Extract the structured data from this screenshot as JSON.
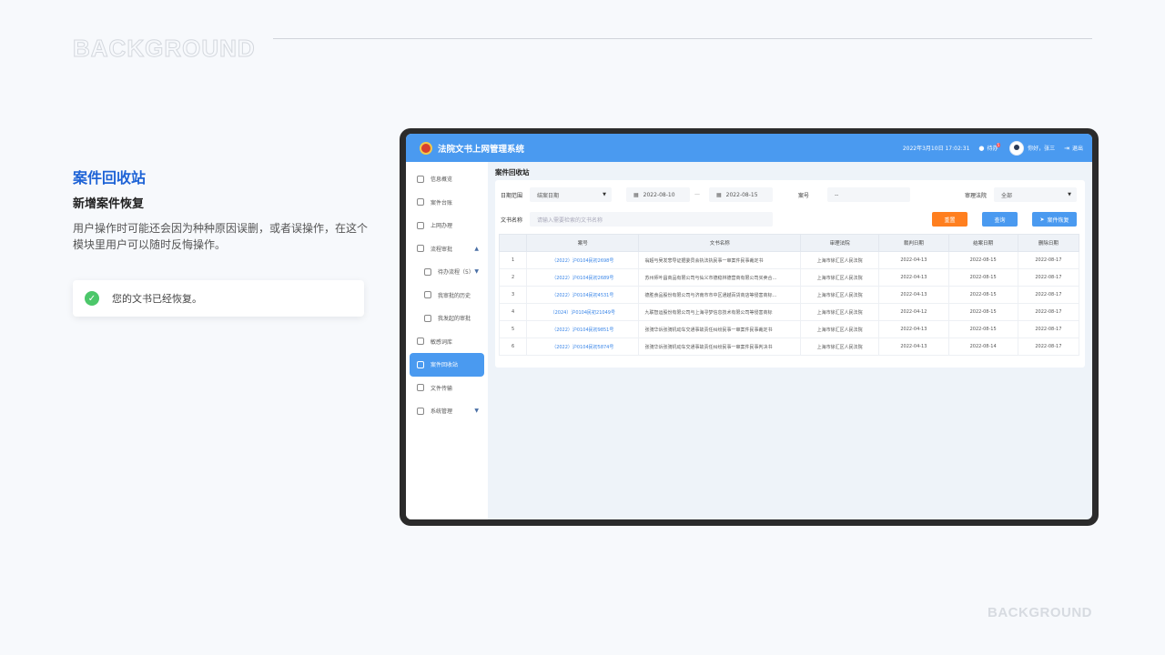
{
  "slide": {
    "bg_title": "BACKGROUND",
    "bg_bottom": "BACKGROUND",
    "title": "案件回收站",
    "subtitle": "新增案件恢复",
    "description": "用户操作时可能还会因为种种原因误删，或者误操作，在这个模块里用户可以随时反悔操作。",
    "toast": {
      "icon": "check-circle-icon",
      "text": "您的文书已经恢复。",
      "color": "#4cc76a"
    }
  },
  "app": {
    "title": "法院文书上网管理系统",
    "datetime": "2022年3月10日 17:02:31",
    "todo_label": "待办",
    "todo_badge": "5",
    "greeting": "你好，张三",
    "logout": "退出",
    "accent": "#4a9af0"
  },
  "sidebar": {
    "items": [
      {
        "label": "信息概览",
        "icon": "overview-icon"
      },
      {
        "label": "案件台账",
        "icon": "ledger-icon"
      },
      {
        "label": "上网办理",
        "icon": "online-icon"
      },
      {
        "label": "流程审批",
        "icon": "approval-icon",
        "arrow": "▲"
      },
      {
        "label": "待办流程（5）",
        "icon": "todo-icon",
        "arrow": "▼"
      },
      {
        "label": "我审批的历史",
        "icon": "history-icon"
      },
      {
        "label": "我发起的审批",
        "icon": "initiated-icon"
      },
      {
        "label": "敏感词库",
        "icon": "sensitive-icon"
      },
      {
        "label": "案件回收站",
        "icon": "recycle-icon"
      },
      {
        "label": "文件传输",
        "icon": "upload-icon"
      },
      {
        "label": "系统管理",
        "icon": "settings-icon",
        "arrow": "▼"
      }
    ]
  },
  "page": {
    "title": "案件回收站",
    "filters": {
      "date_range_label": "日期范围",
      "date_type": "结案日期",
      "date_from": "2022-08-10",
      "date_sep": "—",
      "date_to": "2022-08-15",
      "case_no_label": "案号",
      "case_no_value": "--",
      "court_label": "审理法院",
      "court_value": "全部",
      "doc_name_label": "文书名称",
      "doc_name_placeholder": "请输入需要检索的文书名称",
      "reset": "重置",
      "search": "查询",
      "restore": "案件恢复"
    },
    "table": {
      "headers": [
        "",
        "案号",
        "文书名称",
        "审理法院",
        "裁判日期",
        "结案日期",
        "删除日期"
      ],
      "rows": [
        [
          "1",
          "（2022）沪0104民初2698号",
          "翁超与吴发悲导证据委员会执法执民事一审案件民事裁定书",
          "上海市徐汇区人民法院",
          "2022-04-13",
          "2022-08-15",
          "2022-08-17"
        ],
        [
          "2",
          "（2022）沪0104民初2689号",
          "苏州师叶昌商品有限公司与仙义市德稳林德营商有限公司买卖合…",
          "上海市徐汇区人民法院",
          "2022-04-13",
          "2022-08-15",
          "2022-08-17"
        ],
        [
          "3",
          "（2022）沪0104民初4531号",
          "德胜食品股份有限公司与济南市市中区通越百货商店等侵害商标…",
          "上海市徐汇区人民法院",
          "2022-04-13",
          "2022-08-15",
          "2022-08-17"
        ],
        [
          "4",
          "（2024）沪0104民初21049号",
          "九联智运股份有限公司与上海寻梦信息技术有限公司等侵害商标",
          "上海市徐汇区人民法院",
          "2022-04-12",
          "2022-08-15",
          "2022-08-17"
        ],
        [
          "5",
          "（2022）沪0104民初9851号",
          "张骑华诉张骑机动车交通事故责任纠纷民事一审案件民事裁定书",
          "上海市徐汇区人民法院",
          "2022-04-13",
          "2022-08-15",
          "2022-08-17"
        ],
        [
          "6",
          "（2022）沪0104民初5874号",
          "张骑华诉张骑机动车交通事故责任纠纷民事一审案件民事判决书",
          "上海市徐汇区人民法院",
          "2022-04-13",
          "2022-08-14",
          "2022-08-17"
        ]
      ]
    }
  }
}
